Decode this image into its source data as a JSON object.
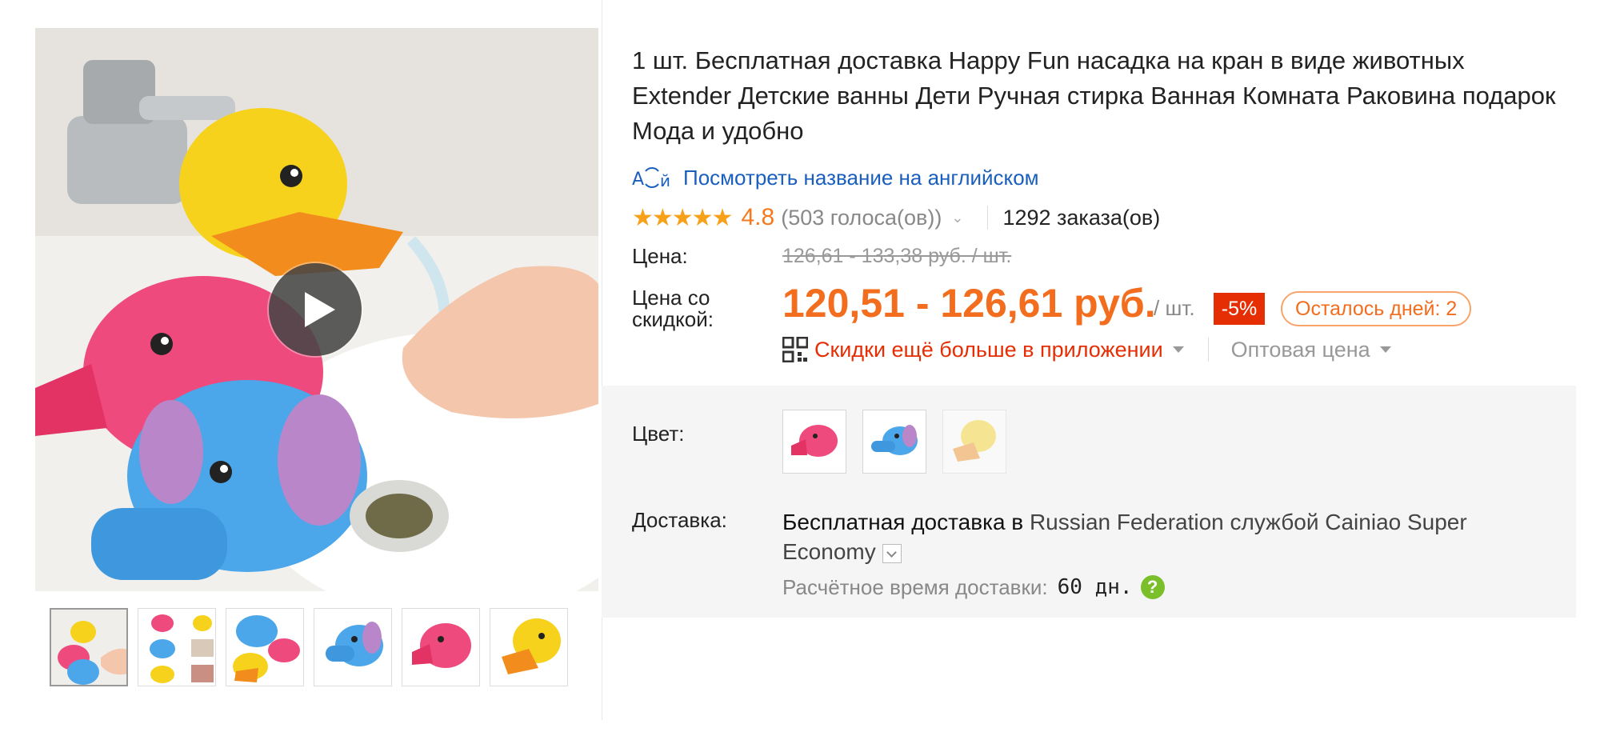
{
  "product": {
    "title": "1 шт. Бесплатная доставка Happy Fun насадка на кран в виде животных Extender Детские ванны Дети Ручная стирка Ванная Комната Раковина подарок Мода и удобно",
    "translate_link": "Посмотреть название на английском",
    "translate_icon_text": "А⟳й"
  },
  "rating": {
    "stars": "★★★★★",
    "value": "4.8",
    "votes": "(503 голоса(ов))",
    "orders": "1292 заказа(ов)"
  },
  "price": {
    "label": "Цена:",
    "original": "126,61 - 133,38 руб. / шт.",
    "discount_label_line1": "Цена со",
    "discount_label_line2": "скидкой:",
    "sale": "120,51 - 126,61 руб.",
    "unit": "/ шт.",
    "discount_badge": "-5%",
    "days_left": "Осталось дней: 2",
    "app_promo": "Скидки ещё больше в приложении",
    "wholesale": "Оптовая цена"
  },
  "color": {
    "label": "Цвет:",
    "options": [
      "pink",
      "blue",
      "yellow"
    ]
  },
  "shipping": {
    "label": "Доставка:",
    "free_text": "Бесплатная доставка в",
    "rest_text": "Russian Federation службой Cainiao Super Economy",
    "eta_label": "Расчётное время доставки:",
    "eta_value": "60 дн.",
    "help_icon": "?"
  },
  "gallery": {
    "thumbnail_count": 6,
    "active_index": 0
  },
  "colors": {
    "accent_orange": "#f26d1e",
    "red": "#e62e04",
    "link_blue": "#1a5fbd",
    "star": "#f7a11a",
    "help_green": "#7bbf2a"
  }
}
